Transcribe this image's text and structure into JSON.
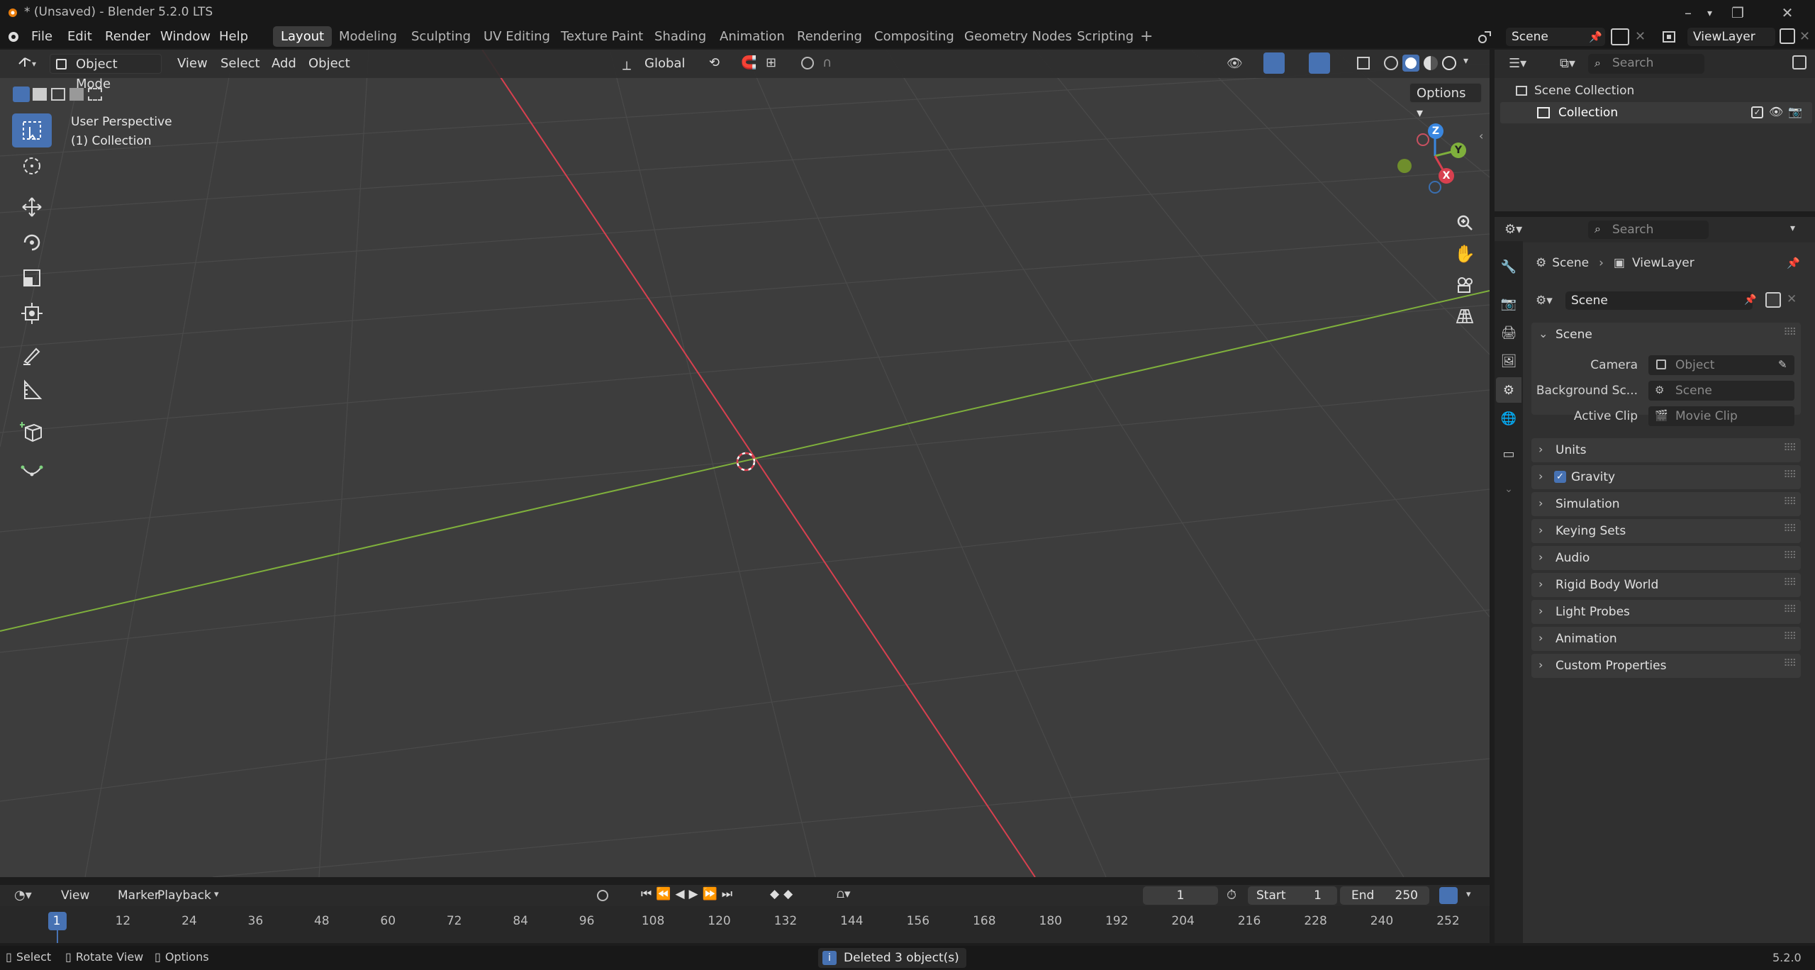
{
  "window": {
    "title": "* (Unsaved) - Blender 5.2.0 LTS"
  },
  "menu": [
    "File",
    "Edit",
    "Render",
    "Window",
    "Help"
  ],
  "workspaces": [
    "Layout",
    "Modeling",
    "Sculpting",
    "UV Editing",
    "Texture Paint",
    "Shading",
    "Animation",
    "Rendering",
    "Compositing",
    "Geometry Nodes",
    "Scripting"
  ],
  "active_workspace": "Layout",
  "scene_selector": "Scene",
  "viewlayer_selector": "ViewLayer",
  "viewport": {
    "mode": "Object Mode",
    "menus": [
      "View",
      "Select",
      "Add",
      "Object"
    ],
    "transform_orientation": "Global",
    "options_label": "Options",
    "overlay_text_line1": "User Perspective",
    "overlay_text_line2": "(1) Collection",
    "gizmo": {
      "z": "Z",
      "y": "Y",
      "x": "X"
    }
  },
  "outliner": {
    "search_placeholder": "Search",
    "items": [
      "Scene Collection",
      "Collection"
    ]
  },
  "properties": {
    "search_placeholder": "Search",
    "breadcrumb": [
      "Scene",
      "ViewLayer"
    ],
    "datablock": "Scene",
    "scene_panel": {
      "title": "Scene",
      "rows": [
        {
          "label": "Camera",
          "placeholder": "Object"
        },
        {
          "label": "Background Sc...",
          "placeholder": "Scene"
        },
        {
          "label": "Active Clip",
          "placeholder": "Movie Clip"
        }
      ]
    },
    "panels": [
      "Units",
      "Gravity",
      "Simulation",
      "Keying Sets",
      "Audio",
      "Rigid Body World",
      "Light Probes",
      "Animation",
      "Custom Properties"
    ],
    "gravity_checked": true
  },
  "timeline": {
    "menus": [
      "View",
      "Marker",
      "Playback"
    ],
    "current_frame": "1",
    "start_label": "Start",
    "start": "1",
    "end_label": "End",
    "end": "250",
    "ruler": [
      "1",
      "12",
      "24",
      "36",
      "48",
      "60",
      "72",
      "84",
      "96",
      "108",
      "120",
      "132",
      "144",
      "156",
      "168",
      "180",
      "192",
      "204",
      "216",
      "228",
      "240",
      "252"
    ]
  },
  "status": {
    "left": [
      "Select",
      "Rotate View",
      "Options"
    ],
    "message": "Deleted 3 object(s)",
    "version": "5.2.0"
  },
  "colors": {
    "accent": "#4772b3",
    "x_axis": "#d8404f",
    "y_axis": "#7fb03c",
    "z_axis": "#3a87e0"
  }
}
